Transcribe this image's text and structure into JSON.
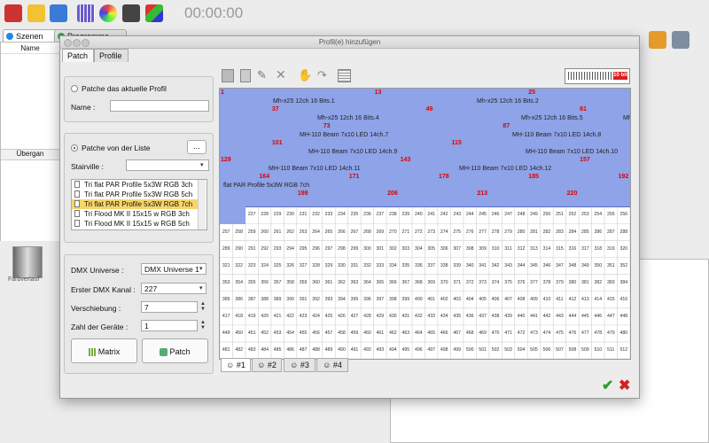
{
  "app": {
    "timer": "00:00:00",
    "tabs": [
      {
        "label": "Szenen"
      },
      {
        "label": "Programme"
      }
    ],
    "left_panel": {
      "header": "Name",
      "section": "Übergan"
    },
    "bottom": {
      "label": "Farbverlauf"
    },
    "colors": {
      "accent": "#8ea3e8",
      "band_dark": "#6f86d6",
      "red": "#e00000",
      "ok": "#2e9e2e"
    }
  },
  "dialog": {
    "title": "Profil(e) hinzufügen",
    "tabs": [
      {
        "label": "Patch"
      },
      {
        "label": "Profile"
      }
    ],
    "patch_current": {
      "radio_label": "Patche das aktuelle Profil",
      "name_label": "Name :",
      "name_value": ""
    },
    "patch_list": {
      "radio_label": "Patche von der Liste",
      "more_button": "...",
      "stairville_label": "Stairville :",
      "stairville_value": "",
      "profiles": [
        {
          "label": "Tri flat PAR Profile 5x3W RGB 3ch",
          "selected": false
        },
        {
          "label": "Tri flat PAR Profile 5x3W RGB 5ch",
          "selected": false
        },
        {
          "label": "Tri flat PAR Profile 5x3W RGB 7ch",
          "selected": true
        },
        {
          "label": "Tri Flood MK II 15x15 w RGB 3ch",
          "selected": false
        },
        {
          "label": "Tri Flood MK II 15x15 w RGB 5ch",
          "selected": false
        }
      ]
    },
    "dmx": {
      "universe_label": "DMX Universe :",
      "universe_value": "DMX Universe 1",
      "channel_label": "Erster DMX Kanal :",
      "channel_value": "227",
      "offset_label": "Verschiebung :",
      "offset_value": "7",
      "count_label": "Zahl der Geräte :",
      "count_value": "1",
      "matrix_button": "Matrix",
      "patch_button": "Patch"
    },
    "grid_toolbar": {
      "bit_label": "10 bit",
      "icons": [
        "copy-icon",
        "paste-icon",
        "edit-icon",
        "delete-icon",
        "hand-icon",
        "redo-icon",
        "grid-icon"
      ]
    },
    "universe_tabs": [
      {
        "label": "#1"
      },
      {
        "label": "#2"
      },
      {
        "label": "#3"
      },
      {
        "label": "#4"
      }
    ],
    "bands": [
      {
        "text": "Mh-x25 12ch 16 Bits.1",
        "num": "1"
      },
      {
        "text": "Mh-x25 12ch 16 Bits.2",
        "num": "13"
      },
      {
        "text": "Mh-x25 12ch 16 Bits.3",
        "num": "25"
      },
      {
        "text": "Mh-x25 12ch 16 Bits.4",
        "num": "37"
      },
      {
        "text": "Mh-x25 12ch 16 Bits.5",
        "num": "49"
      },
      {
        "text": "Mh-x25 12ch 16 Bits.6",
        "num": "61"
      },
      {
        "text": "MH-110 Beam 7x10 LED 14ch.7",
        "num": "101"
      },
      {
        "text": "MH-110 Beam 7x10 LED 14ch.8",
        "num": "115"
      },
      {
        "text": "MH-110 Beam 7x10 LED 14ch.9",
        "num": "129"
      },
      {
        "text": "MH-110 Beam 7x10 LED 14ch.10",
        "num": "143"
      },
      {
        "text": "MH-110 Beam 7x10 LED 14ch.11",
        "num": "157"
      },
      {
        "text": "MH-110 Beam 7x10 LED 14ch.12",
        "num": "171"
      },
      {
        "text": "flat PAR Profile 5x3W RGB 7ch",
        "num": "185"
      }
    ],
    "red_numbers": [
      "1",
      "13",
      "25",
      "37",
      "49",
      "61",
      "73",
      "87",
      "101",
      "115",
      "129",
      "143",
      "157",
      "164",
      "171",
      "178",
      "185",
      "192",
      "199",
      "206",
      "213",
      "220"
    ],
    "band_labels": [
      {
        "text": "Mh-x25 12ch 16 Bits.1"
      },
      {
        "text": "Mh-x25 12ch 16 Bits.2"
      },
      {
        "text": "Mh-x25 12ch 16 Bits.4"
      },
      {
        "text": "Mh-x25 12ch 16 Bits.5"
      },
      {
        "text": "Mh-x25 12ch 16 Bits.6"
      },
      {
        "text": "MH-110 Beam 7x10 LED 14ch.7"
      },
      {
        "text": "MH-110 Beam 7x10 LED 14ch.8"
      },
      {
        "text": "MH-110 Beam 7x10 LED 14ch.9"
      },
      {
        "text": "MH-110 Beam 7x10 LED 14ch.10"
      },
      {
        "text": "MH-110 Beam 7x10 LED 14ch.11"
      },
      {
        "text": "MH-110 Beam 7x10 LED 14ch.12"
      },
      {
        "text": "flat PAR Profile 5x3W RGB 7ch"
      }
    ],
    "footer": {
      "ok": "✔",
      "cancel": "✖"
    },
    "grid_first_free": 227,
    "grid_last": 512
  }
}
